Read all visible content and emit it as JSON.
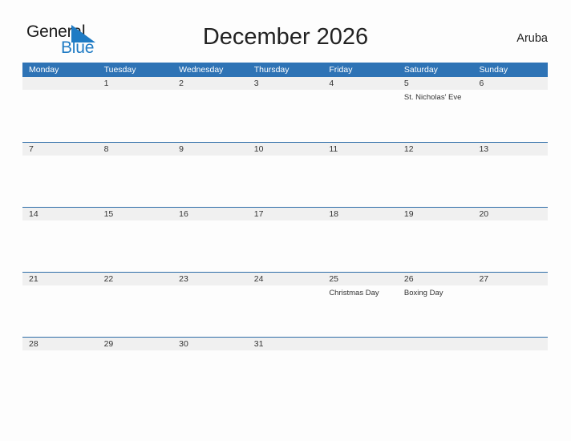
{
  "brand": {
    "name_part1": "General",
    "name_part2": "Blue",
    "triangle_color": "#1f7bc4"
  },
  "header": {
    "title": "December 2026",
    "locale": "Aruba"
  },
  "theme": {
    "header_blue": "#2e73b5",
    "rule_blue": "#2e6da8",
    "strip_gray": "#f0f0f0",
    "page_background": "#fdfdfd",
    "text": "#333333"
  },
  "calendar": {
    "weekdays": [
      "Monday",
      "Tuesday",
      "Wednesday",
      "Thursday",
      "Friday",
      "Saturday",
      "Sunday"
    ],
    "weeks": [
      {
        "days": [
          {
            "num": "",
            "events": []
          },
          {
            "num": "1",
            "events": []
          },
          {
            "num": "2",
            "events": []
          },
          {
            "num": "3",
            "events": []
          },
          {
            "num": "4",
            "events": []
          },
          {
            "num": "5",
            "events": [
              "St. Nicholas' Eve"
            ]
          },
          {
            "num": "6",
            "events": []
          }
        ]
      },
      {
        "days": [
          {
            "num": "7",
            "events": []
          },
          {
            "num": "8",
            "events": []
          },
          {
            "num": "9",
            "events": []
          },
          {
            "num": "10",
            "events": []
          },
          {
            "num": "11",
            "events": []
          },
          {
            "num": "12",
            "events": []
          },
          {
            "num": "13",
            "events": []
          }
        ]
      },
      {
        "days": [
          {
            "num": "14",
            "events": []
          },
          {
            "num": "15",
            "events": []
          },
          {
            "num": "16",
            "events": []
          },
          {
            "num": "17",
            "events": []
          },
          {
            "num": "18",
            "events": []
          },
          {
            "num": "19",
            "events": []
          },
          {
            "num": "20",
            "events": []
          }
        ]
      },
      {
        "days": [
          {
            "num": "21",
            "events": []
          },
          {
            "num": "22",
            "events": []
          },
          {
            "num": "23",
            "events": []
          },
          {
            "num": "24",
            "events": []
          },
          {
            "num": "25",
            "events": [
              "Christmas Day"
            ]
          },
          {
            "num": "26",
            "events": [
              "Boxing Day"
            ]
          },
          {
            "num": "27",
            "events": []
          }
        ]
      },
      {
        "days": [
          {
            "num": "28",
            "events": []
          },
          {
            "num": "29",
            "events": []
          },
          {
            "num": "30",
            "events": []
          },
          {
            "num": "31",
            "events": []
          },
          {
            "num": "",
            "events": []
          },
          {
            "num": "",
            "events": []
          },
          {
            "num": "",
            "events": []
          }
        ]
      }
    ]
  }
}
